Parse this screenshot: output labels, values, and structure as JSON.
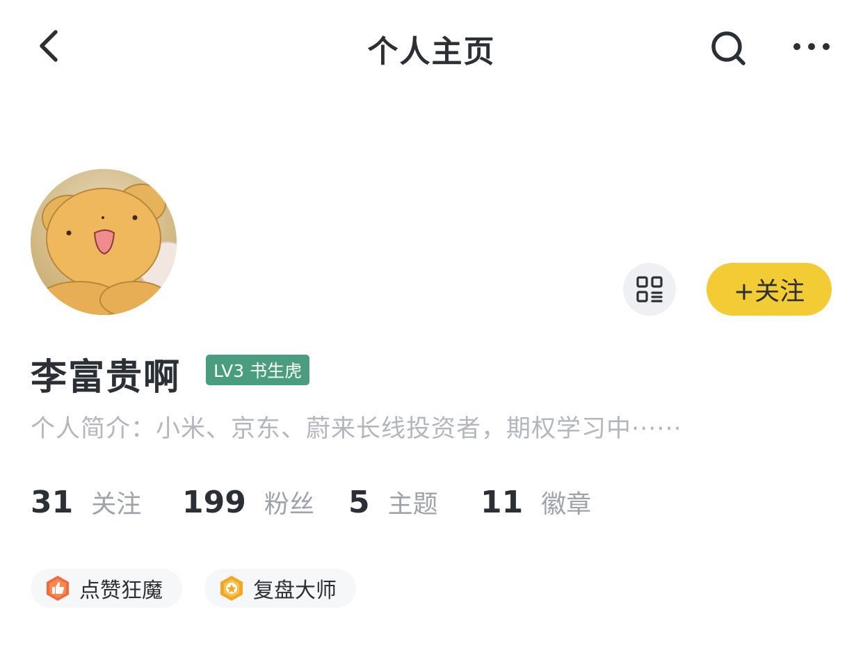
{
  "header": {
    "title": "个人主页",
    "back_icon": "chevron-left-icon",
    "search_icon": "search-icon",
    "more_icon": "more-icon"
  },
  "profile": {
    "username": "李富贵啊",
    "level_badge": "LV3 书生虎",
    "bio": "个人简介：小米、京东、蔚来长线投资者，期权学习中······",
    "follow_button": "+关注",
    "qr_icon": "qr-code-icon"
  },
  "stats": [
    {
      "value": "31",
      "label": "关注"
    },
    {
      "value": "199",
      "label": "粉丝"
    },
    {
      "value": "5",
      "label": "主题"
    },
    {
      "value": "11",
      "label": "徽章"
    }
  ],
  "badges": [
    {
      "label": "点赞狂魔",
      "icon": "thumbs-up-badge-icon"
    },
    {
      "label": "复盘大师",
      "icon": "star-badge-icon"
    }
  ],
  "colors": {
    "accent_yellow": "#f3cb35",
    "level_green": "#4a9d7e",
    "text_primary": "#2b2f36",
    "text_secondary": "#9ea3aa"
  }
}
